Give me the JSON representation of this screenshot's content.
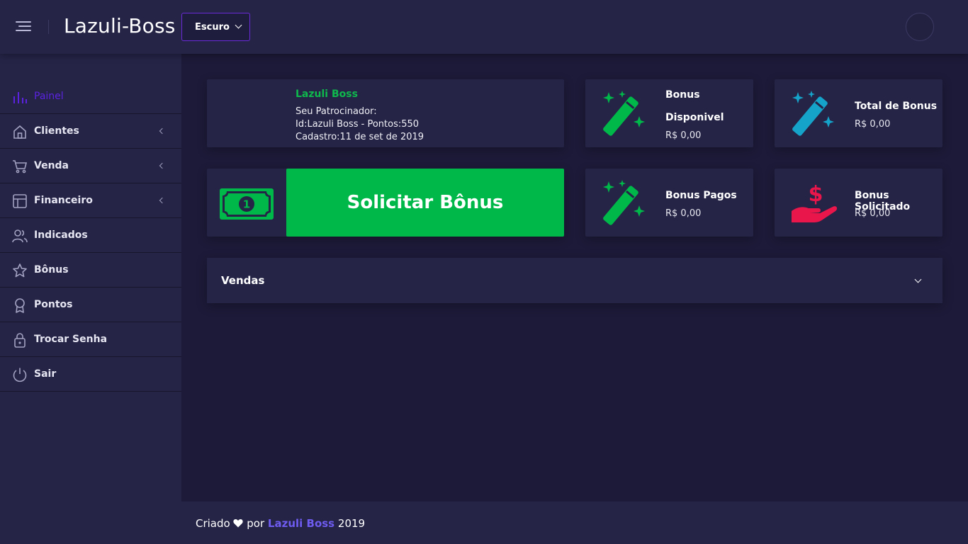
{
  "header": {
    "title": "Lazuli-Boss",
    "theme_select": {
      "selected": "Escuro"
    }
  },
  "sidebar": {
    "items": [
      {
        "label": "Painel",
        "icon": "bar-chart-icon",
        "active": true
      },
      {
        "label": "Clientes",
        "icon": "home-icon",
        "has_submenu": true
      },
      {
        "label": "Venda",
        "icon": "cart-icon",
        "has_submenu": true
      },
      {
        "label": "Financeiro",
        "icon": "layout-icon",
        "has_submenu": true
      },
      {
        "label": "Indicados",
        "icon": "users-icon"
      },
      {
        "label": "Bônus",
        "icon": "star-icon"
      },
      {
        "label": "Pontos",
        "icon": "award-icon"
      },
      {
        "label": "Trocar Senha",
        "icon": "lock-icon"
      },
      {
        "label": "Sair",
        "icon": "power-icon"
      }
    ]
  },
  "profile": {
    "name": "Lazuli Boss",
    "sponsor_label": "Seu Patrocinador:",
    "id_line": "Id:Lazuli Boss - Pontos:550",
    "register_line": "Cadastro:11 de set de 2019"
  },
  "stats": {
    "bonus_disponivel": {
      "title_line1": "Bonus",
      "title_line2": "Disponivel",
      "value": "R$ 0,00",
      "icon": "magic-wand-icon"
    },
    "total_bonus": {
      "title": "Total de Bonus",
      "value": "R$ 0,00",
      "icon": "magic-wand-icon"
    },
    "bonus_pagos": {
      "title": "Bonus Pagos",
      "value": "R$ 0,00",
      "icon": "magic-wand-icon"
    },
    "bonus_solicitado": {
      "title": "Bonus Solicitado",
      "value": "R$ 0,00",
      "icon": "hand-dollar-icon"
    }
  },
  "request_bonus": {
    "label": "Solicitar Bônus",
    "icon": "money-bill-icon"
  },
  "vendas": {
    "label": "Vendas"
  },
  "footer": {
    "prefix": "Criado",
    "by": "por",
    "brand": "Lazuli Boss",
    "year": "2019"
  },
  "colors": {
    "accent": "#5b23e0",
    "green": "#00b84a",
    "teal": "#16a3c9",
    "red": "#e8164a",
    "link": "#6e5cf0"
  }
}
